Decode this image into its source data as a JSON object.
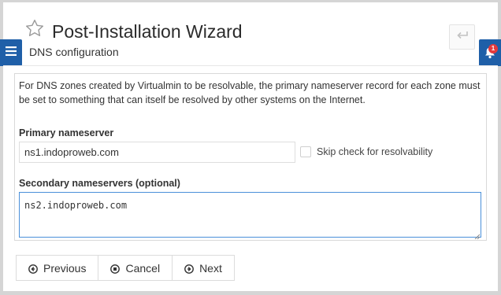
{
  "header": {
    "title": "Post-Installation Wizard",
    "subtitle": "DNS configuration",
    "return_icon": "return-arrow-icon"
  },
  "side": {
    "menu_icon": "hamburger-menu-icon",
    "notification_icon": "bell-icon",
    "notification_badge": "1"
  },
  "form": {
    "intro": "For DNS zones created by Virtualmin to be resolvable, the primary nameserver record for each zone must be set to something that can itself be resolved by other systems on the Internet.",
    "primary_label": "Primary nameserver",
    "primary_value": "ns1.indoproweb.com",
    "skip_check_label": "Skip check for resolvability",
    "skip_check_checked": false,
    "secondary_label": "Secondary nameservers (optional)",
    "secondary_value": "ns2.indoproweb.com"
  },
  "buttons": {
    "previous": "Previous",
    "cancel": "Cancel",
    "next": "Next"
  },
  "colors": {
    "accent": "#1f5fa8",
    "focus_border": "#4a90d9",
    "badge": "#e4393c"
  }
}
